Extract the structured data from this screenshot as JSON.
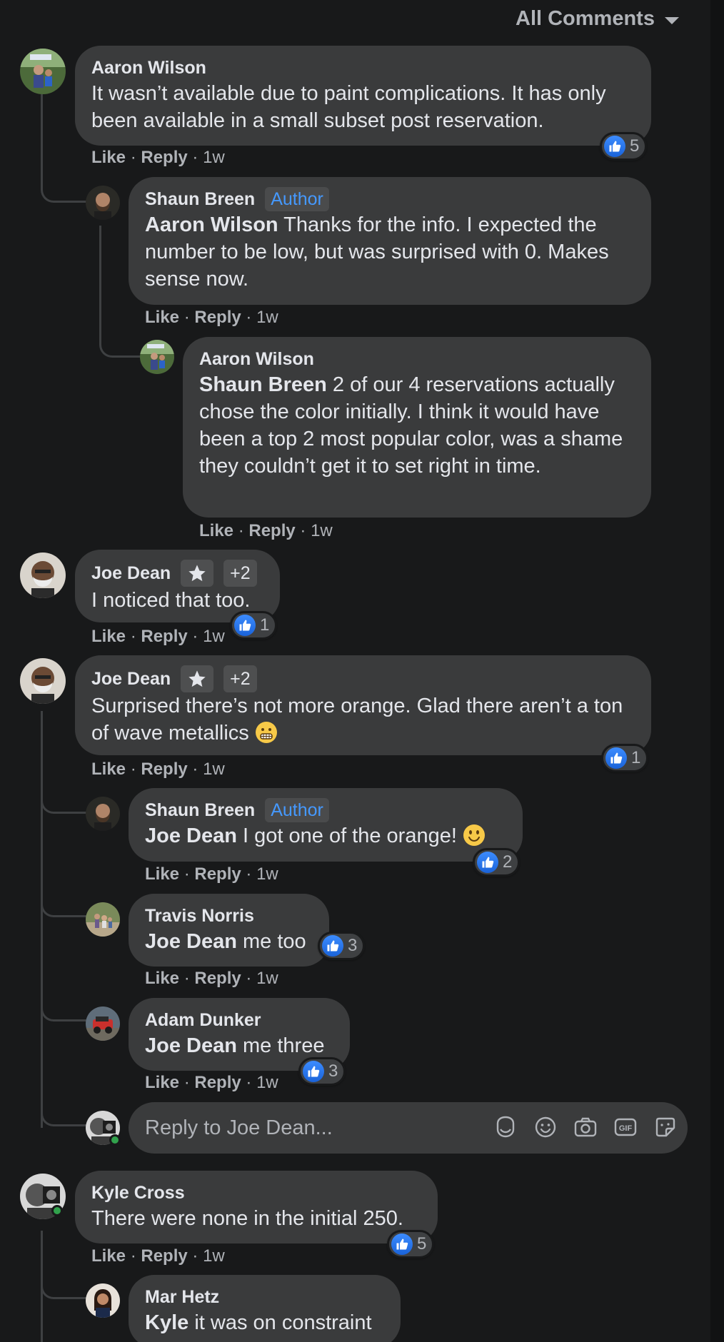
{
  "sort": {
    "label": "All Comments"
  },
  "meta": {
    "like": "Like",
    "reply": "Reply",
    "sep": "·"
  },
  "comments": [
    {
      "author": "Aaron Wilson",
      "text": "It wasn’t available due to paint complications. It has only been available in a small subset post reservation.",
      "time": "1w",
      "likes": "5"
    },
    {
      "author": "Shaun Breen",
      "badge": "Author",
      "mention": "Aaron Wilson",
      "text": " Thanks for the info. I expected the number to be low, but was surprised with 0. Makes sense now.",
      "time": "1w"
    },
    {
      "author": "Aaron Wilson",
      "mention": "Shaun Breen",
      "text": " 2 of our 4 reservations actually chose the color initially. I think it would have been a top 2 most popular color, was a shame they couldn’t get it to set right in time.",
      "time": "1w"
    },
    {
      "author": "Joe Dean",
      "extra_badges": "+2",
      "text": "I noticed that too.",
      "time": "1w",
      "likes": "1"
    },
    {
      "author": "Joe Dean",
      "extra_badges": "+2",
      "text": "Surprised there’s not more orange. Glad there aren’t a ton of wave metallics",
      "emoji": "grimacing-emoji",
      "time": "1w",
      "likes": "1"
    },
    {
      "author": "Shaun Breen",
      "badge": "Author",
      "mention": "Joe Dean",
      "text": " I got one of the orange!",
      "emoji": "smiling-emoji",
      "time": "1w",
      "likes": "2"
    },
    {
      "author": "Travis Norris",
      "mention": "Joe Dean",
      "text": " me too",
      "time": "1w",
      "likes": "3"
    },
    {
      "author": "Adam Dunker",
      "mention": "Joe Dean",
      "text": " me three",
      "time": "1w",
      "likes": "3"
    },
    {
      "author": "Kyle Cross",
      "text": "There were none in the initial 250.",
      "time": "1w",
      "likes": "5"
    },
    {
      "author": "Mar Hetz",
      "mention": "Kyle",
      "text": " it was on constraint"
    }
  ],
  "reply_box": {
    "placeholder": "Reply to Joe Dean...",
    "tools": [
      "avatar-sticker-icon",
      "emoji-icon",
      "camera-icon",
      "gif-icon",
      "sticker-icon"
    ],
    "gif_label": "GIF"
  },
  "colors": {
    "background": "#18191a",
    "bubble": "#3a3b3c",
    "author_badge": "#4599ff",
    "like_blue": "#2d7cf6",
    "online": "#31a24c"
  }
}
